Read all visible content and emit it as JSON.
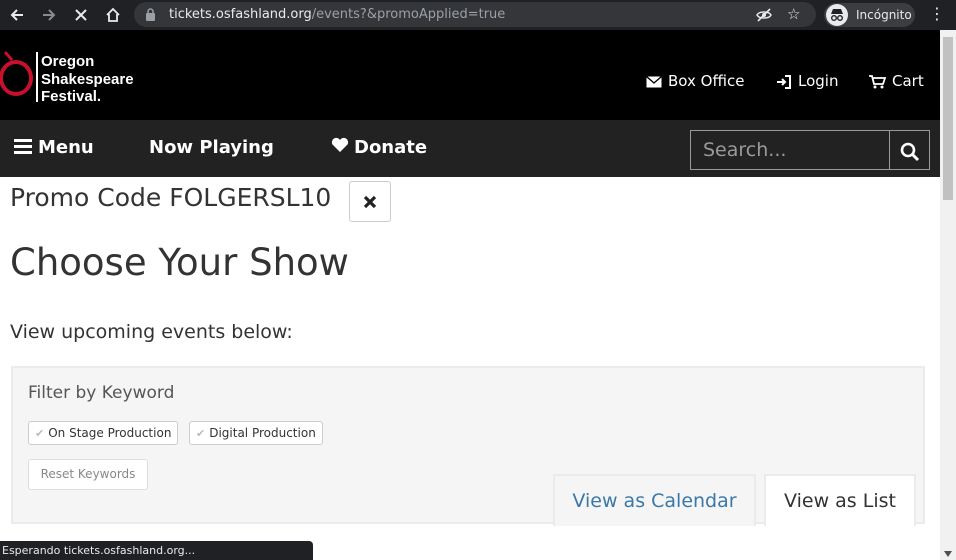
{
  "browser": {
    "url_host": "tickets.osfashland.org",
    "url_path": "/events?&promoApplied=true",
    "profile_label": "Incógnito",
    "status_text": "Esperando tickets.osfashland.org..."
  },
  "site": {
    "logo_lines": [
      "Oregon",
      "Shakespeare",
      "Festival."
    ],
    "top_nav": [
      {
        "label": "Box Office",
        "icon": "envelope-icon"
      },
      {
        "label": "Login",
        "icon": "sign-in-icon"
      },
      {
        "label": "Cart",
        "icon": "cart-icon"
      }
    ],
    "main_nav": [
      {
        "label": "Menu",
        "icon": "hamburger-icon"
      },
      {
        "label": "Now Playing"
      },
      {
        "label": "Donate",
        "icon": "heart-icon"
      }
    ],
    "search_placeholder": "Search..."
  },
  "content": {
    "promo_text": "Promo Code FOLGERSL10",
    "heading": "Choose Your Show",
    "subheading": "View upcoming events below:",
    "filter": {
      "title": "Filter by Keyword",
      "chips": [
        "On Stage Production",
        "Digital Production"
      ],
      "reset_label": "Reset Keywords"
    },
    "view_tabs": [
      {
        "label": "View as Calendar",
        "active": false
      },
      {
        "label": "View as List",
        "active": true
      }
    ]
  },
  "colors": {
    "header_bg": "#000000",
    "nav_bg": "#222222",
    "logo_red": "#c8102e",
    "link_blue": "#3a78a8"
  }
}
